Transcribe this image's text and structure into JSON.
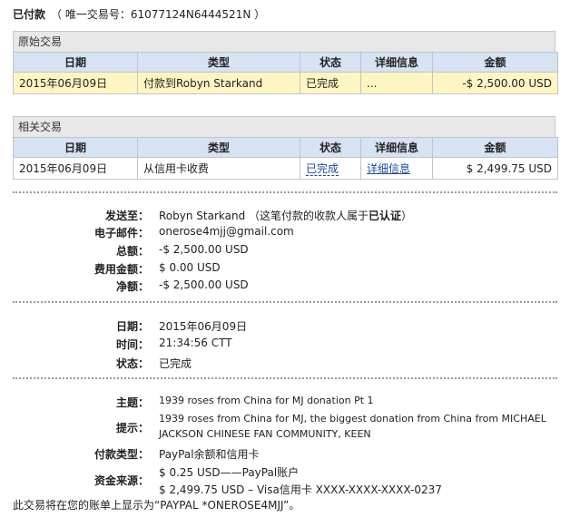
{
  "header": {
    "title": "已付款",
    "txn_id": "（ 唯一交易号：61077124N6444521N ）"
  },
  "original": {
    "title": "原始交易",
    "columns": [
      "日期",
      "类型",
      "状态",
      "详细信息",
      "金额"
    ],
    "row": {
      "date": "2015年06月09日",
      "type": "付款到Robyn Starkand",
      "status": "已完成",
      "details": "...",
      "amount": "-$ 2,500.00 USD"
    }
  },
  "related": {
    "title": "相关交易",
    "columns": [
      "日期",
      "类型",
      "状态",
      "详细信息",
      "金额"
    ],
    "row": {
      "date": "2015年06月09日",
      "type": "从信用卡收费",
      "status": "已完成",
      "details": "详细信息",
      "amount": "$ 2,499.75 USD"
    }
  },
  "recipient": {
    "sent_to_label": "发送至：",
    "sent_to_value": "Robyn Starkand",
    "sent_to_note_prefix": "（这笔付款的收款人属于",
    "sent_to_note_bold": "已认证",
    "sent_to_note_suffix": "）",
    "email_label": "电子邮件：",
    "email_value": "onerose4mjj@gmail.com",
    "total_label": "总额：",
    "total_value": "-$ 2,500.00 USD",
    "fee_label": "费用金额：",
    "fee_value": "$ 0.00 USD",
    "net_label": "净额：",
    "net_value": "-$ 2,500.00 USD"
  },
  "timing": {
    "date_label": "日期：",
    "date_value": "2015年06月09日",
    "time_label": "时间：",
    "time_value": "21:34:56 CTT",
    "status_label": "状态：",
    "status_value": "已完成"
  },
  "info": {
    "subject_label": "主题：",
    "subject_value": "1939 roses from China for MJ donation Pt 1",
    "note_label": "提示：",
    "note_line1": "1939 roses from China for MJ, the biggest donation from China from MICHAEL",
    "note_line2": "JACKSON CHINESE FAN COMMUNITY, KEEN",
    "pay_type_label": "付款类型：",
    "pay_type_value": "PayPal余额和信用卡",
    "source_label": "资金来源：",
    "source_line1": "$ 0.25 USD——PayPal账户",
    "source_line2": "$ 2,499.75 USD – Visa信用卡 XXXX-XXXX-XXXX-0237"
  },
  "footer": {
    "statement": "此交易将在您的账单上显示为“PAYPAL *ONEROSE4MJJ”。"
  }
}
